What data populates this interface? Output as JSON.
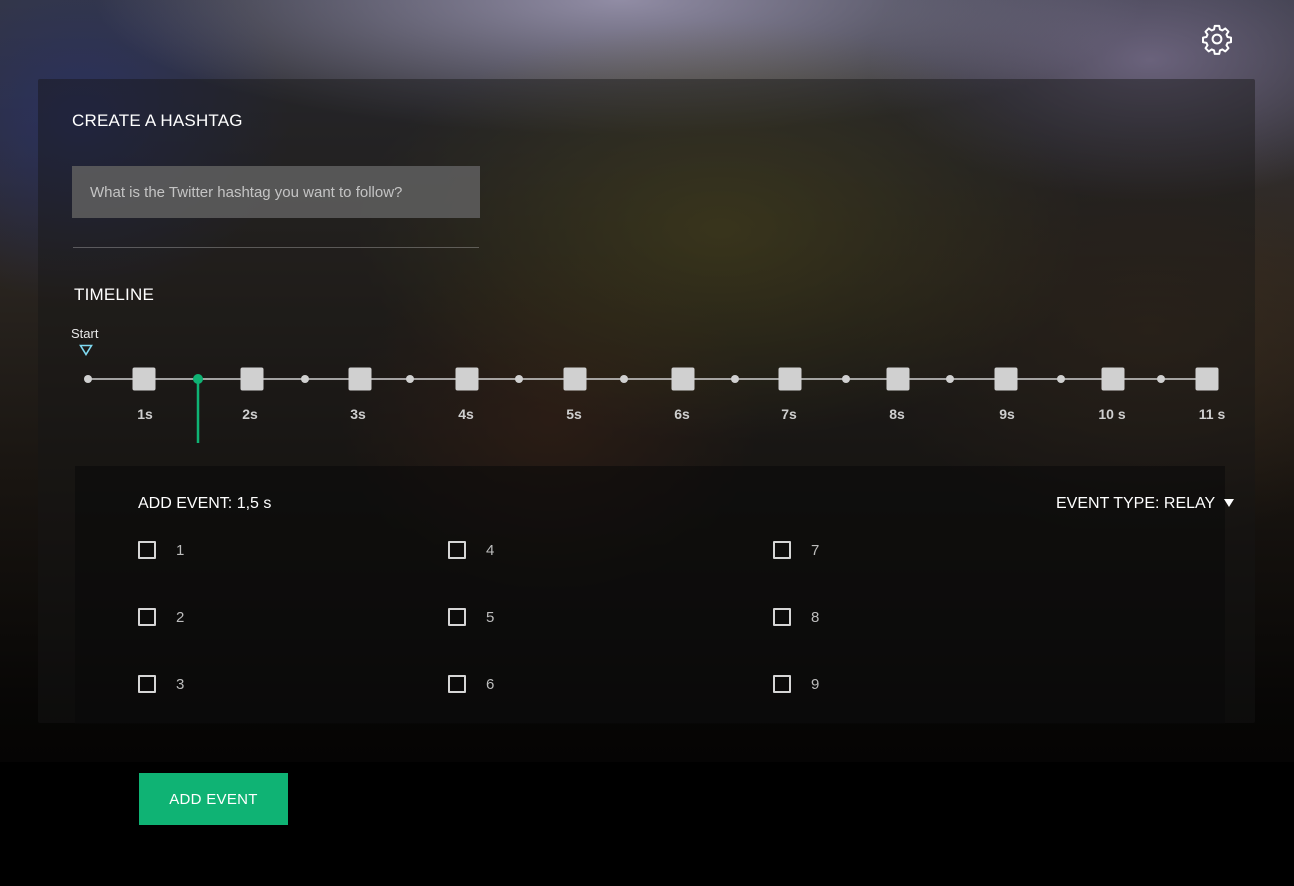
{
  "hashtag": {
    "title": "CREATE A HASHTAG",
    "placeholder": "What is the Twitter hashtag you want to follow?",
    "value": ""
  },
  "timeline": {
    "title": "TIMELINE",
    "start_label": "Start",
    "tick_labels": [
      "1s",
      "2s",
      "3s",
      "4s",
      "5s",
      "6s",
      "7s",
      "8s",
      "9s",
      "10 s",
      "11 s"
    ],
    "selected_time": 1.5,
    "colors": {
      "track": "#d0d0d0",
      "selected": "#0fb374",
      "start_marker": "#7fd9f0"
    }
  },
  "event": {
    "title": "ADD EVENT: 1,5 s",
    "type_label": "EVENT TYPE: RELAY",
    "options": [
      {
        "label": "1",
        "checked": false
      },
      {
        "label": "2",
        "checked": false
      },
      {
        "label": "3",
        "checked": false
      },
      {
        "label": "4",
        "checked": false
      },
      {
        "label": "5",
        "checked": false
      },
      {
        "label": "6",
        "checked": false
      },
      {
        "label": "7",
        "checked": false
      },
      {
        "label": "8",
        "checked": false
      },
      {
        "label": "9",
        "checked": false
      }
    ],
    "submit_label": "ADD EVENT",
    "accent": "#0fb374"
  },
  "icons": {
    "settings": "gear-icon"
  }
}
